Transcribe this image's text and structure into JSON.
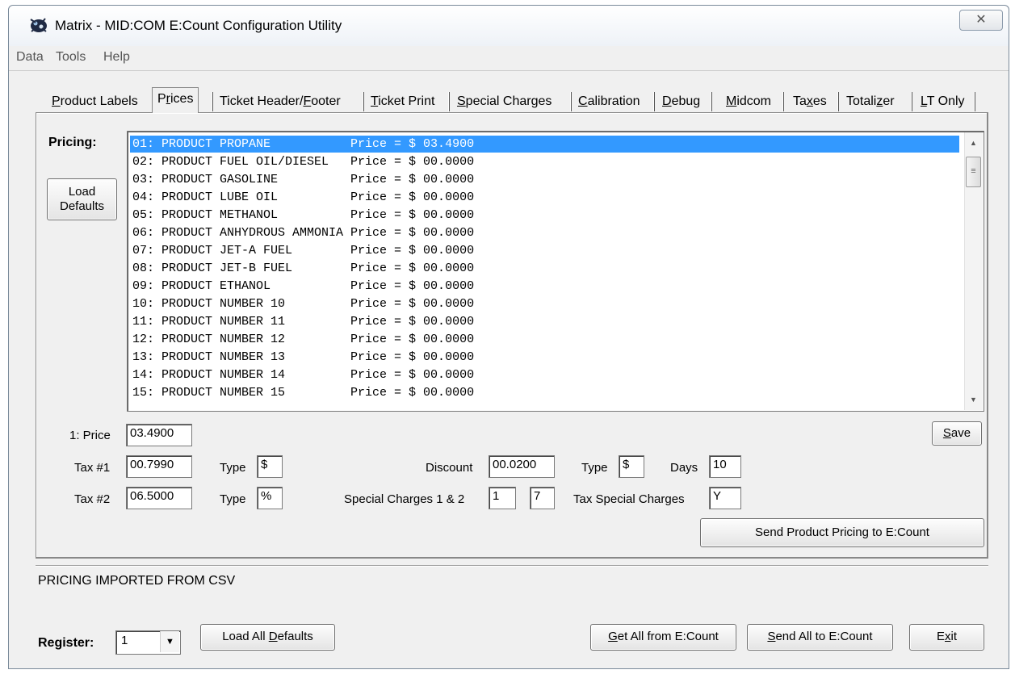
{
  "window": {
    "title": "Matrix - MID:COM E:Count Configuration Utility",
    "close_glyph": "✕"
  },
  "menu": {
    "items": [
      "Data",
      "Tools",
      "Help"
    ]
  },
  "tabs": [
    {
      "pre": "",
      "u": "P",
      "post": "roduct Labels"
    },
    {
      "pre": "P",
      "u": "r",
      "post": "ices"
    },
    {
      "pre": "Ticket Header/",
      "u": "F",
      "post": "ooter"
    },
    {
      "pre": "",
      "u": "T",
      "post": "icket Print"
    },
    {
      "pre": "",
      "u": "S",
      "post": "pecial Charges"
    },
    {
      "pre": "",
      "u": "C",
      "post": "alibration"
    },
    {
      "pre": "",
      "u": "D",
      "post": "ebug"
    },
    {
      "pre": "",
      "u": "M",
      "post": "idcom"
    },
    {
      "pre": "Ta",
      "u": "x",
      "post": "es"
    },
    {
      "pre": "Totali",
      "u": "z",
      "post": "er"
    },
    {
      "pre": "",
      "u": "L",
      "post": "T Only"
    }
  ],
  "pricing": {
    "label": "Pricing:",
    "load_defaults_line1": "Load",
    "load_defaults_line2": "Defaults",
    "rows": [
      "01: PRODUCT PROPANE           Price = $ 03.4900",
      "02: PRODUCT FUEL OIL/DIESEL   Price = $ 00.0000",
      "03: PRODUCT GASOLINE          Price = $ 00.0000",
      "04: PRODUCT LUBE OIL          Price = $ 00.0000",
      "05: PRODUCT METHANOL          Price = $ 00.0000",
      "06: PRODUCT ANHYDROUS AMMONIA Price = $ 00.0000",
      "07: PRODUCT JET-A FUEL        Price = $ 00.0000",
      "08: PRODUCT JET-B FUEL        Price = $ 00.0000",
      "09: PRODUCT ETHANOL           Price = $ 00.0000",
      "10: PRODUCT NUMBER 10         Price = $ 00.0000",
      "11: PRODUCT NUMBER 11         Price = $ 00.0000",
      "12: PRODUCT NUMBER 12         Price = $ 00.0000",
      "13: PRODUCT NUMBER 13         Price = $ 00.0000",
      "14: PRODUCT NUMBER 14         Price = $ 00.0000",
      "15: PRODUCT NUMBER 15         Price = $ 00.0000"
    ],
    "selected_index": 0
  },
  "fields": {
    "price_label": "1: Price",
    "price_value": "03.4900",
    "tax1_label": "Tax #1",
    "tax1_value": "00.7990",
    "tax1_type_label": "Type",
    "tax1_type_value": "$",
    "tax2_label": "Tax #2",
    "tax2_value": "06.5000",
    "tax2_type_label": "Type",
    "tax2_type_value": "%",
    "discount_label": "Discount",
    "discount_value": "00.0200",
    "discount_type_label": "Type",
    "discount_type_value": "$",
    "days_label": "Days",
    "days_value": "10",
    "special_charges_label": "Special Charges 1 & 2",
    "special_charge1_value": "1",
    "special_charge2_value": "7",
    "tax_special_label": "Tax Special Charges",
    "tax_special_value": "Y"
  },
  "buttons": {
    "save_u": "S",
    "save_rest": "ave",
    "send_pricing": "Send Product Pricing to E:Count",
    "load_all_pre": "Load All ",
    "load_all_u": "D",
    "load_all_post": "efaults",
    "get_all_u": "G",
    "get_all_rest": "et All from E:Count",
    "send_all_u": "S",
    "send_all_rest": "end All to E:Count",
    "exit_pre": "E",
    "exit_u": "x",
    "exit_post": "it"
  },
  "status": {
    "message": "PRICING IMPORTED FROM CSV"
  },
  "register": {
    "label": "Register:",
    "value": "1"
  },
  "colors": {
    "selection": "#3399ff",
    "background": "#f0f0f0"
  }
}
